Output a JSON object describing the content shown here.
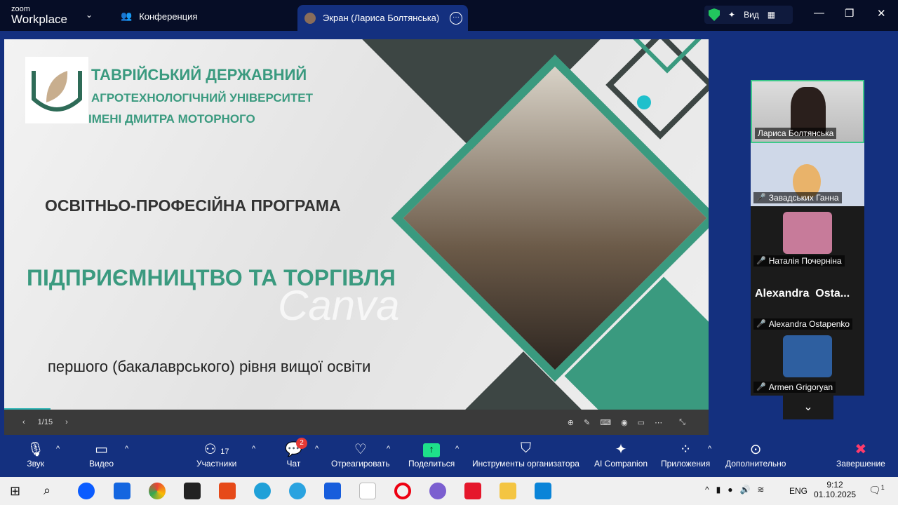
{
  "titlebar": {
    "logo_small": "zoom",
    "logo_big": "Workplace",
    "conference": "Конференция",
    "tab": "Экран (Лариса Болтянська)",
    "view": "Вид"
  },
  "slide": {
    "uni1": "ТАВРІЙСЬКИЙ ДЕРЖАВНИЙ",
    "uni2": "АГРОТЕХНОЛОГІЧНИЙ УНІВЕРСИТЕТ",
    "uni3": "ІМЕНІ ДМИТРА МОТОРНОГО",
    "program": "ОСВІТНЬО-ПРОФЕСІЙНА ПРОГРАМА",
    "title": "ПІДПРИЄМНИЦТВО ТА ТОРГІВЛЯ",
    "level": "першого (бакалаврського) рівня вищої освіти",
    "watermark": "Canva",
    "page": "1/15"
  },
  "participants": [
    {
      "name": "Лариса Болтянська",
      "muted": false
    },
    {
      "name": "Завадських Ганна",
      "muted": true
    },
    {
      "name": "Наталія Почерніна",
      "muted": true
    },
    {
      "name": "Alexandra Ostapenko",
      "muted": true,
      "display": "Alexandra  Osta..."
    },
    {
      "name": "Armen Grigoryan",
      "muted": true
    }
  ],
  "toolbar": {
    "audio": "Звук",
    "video": "Видео",
    "participants": "Участники",
    "participants_count": "17",
    "chat": "Чат",
    "chat_badge": "2",
    "react": "Отреагировать",
    "share": "Поделиться",
    "host_tools": "Инструменты организатора",
    "ai": "AI Companion",
    "apps": "Приложения",
    "more": "Дополнительно",
    "end": "Завершение"
  },
  "taskbar": {
    "time": "9:12",
    "date": "01.10.2025",
    "lang": "ENG",
    "notif": "1"
  }
}
